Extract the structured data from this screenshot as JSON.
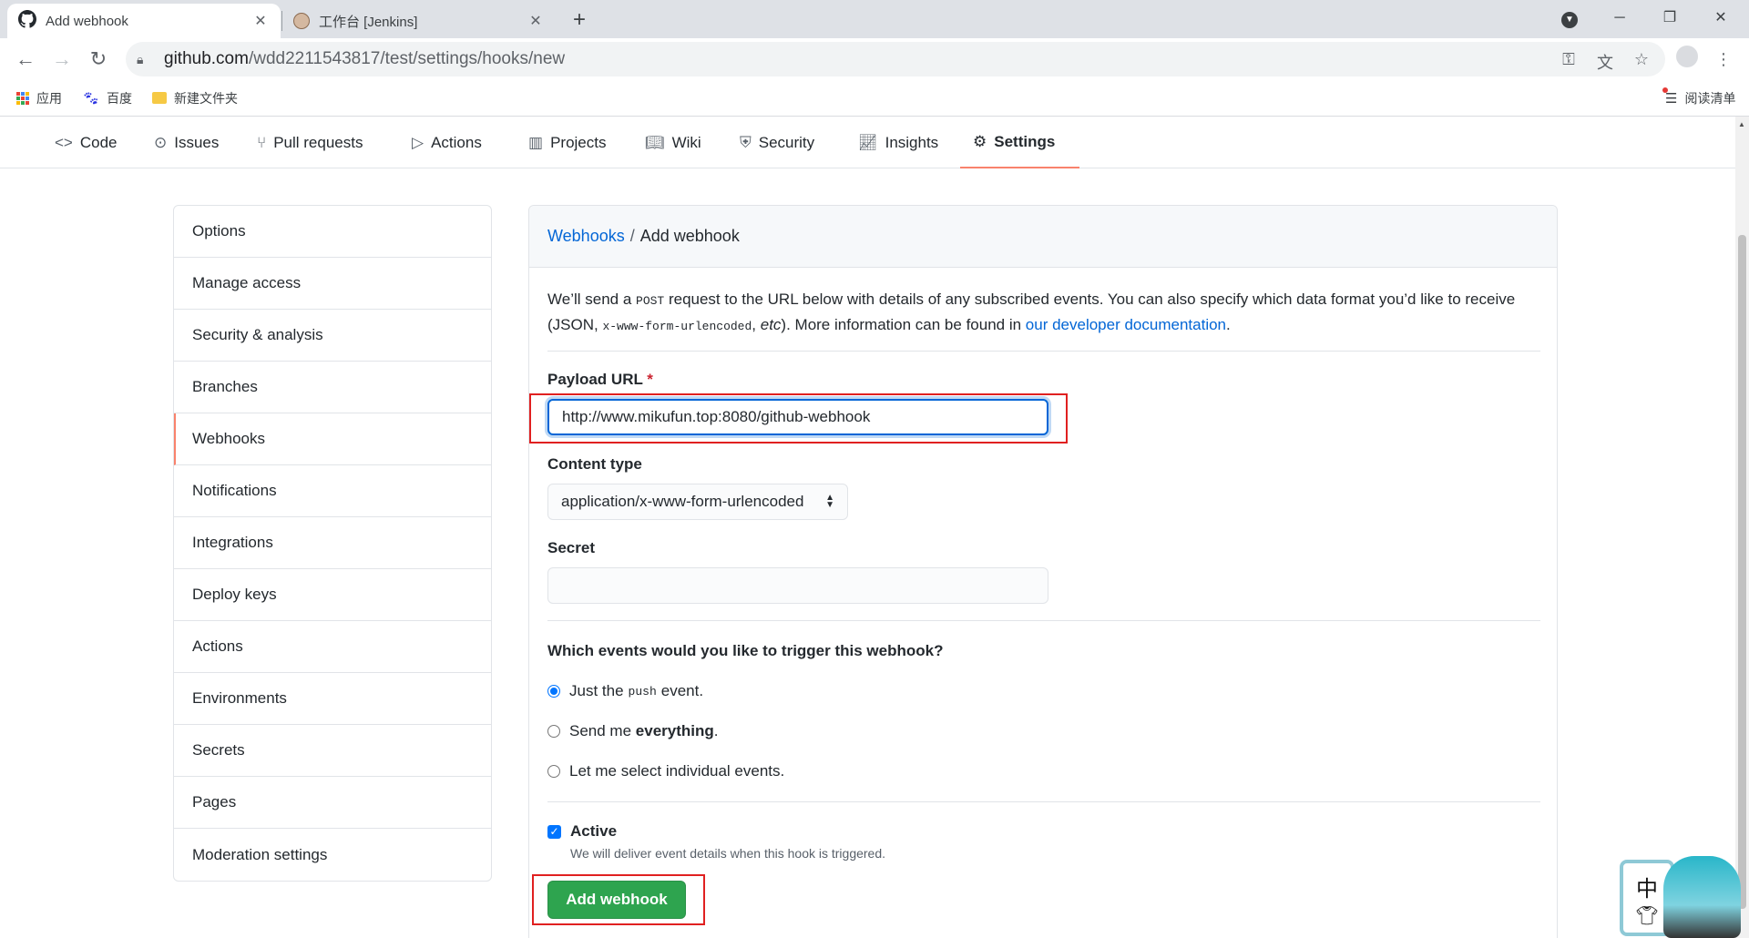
{
  "browser": {
    "tabs": [
      {
        "title": "Add webhook",
        "icon": "github-icon",
        "active": true
      },
      {
        "title": "工作台 [Jenkins]",
        "icon": "jenkins-icon",
        "active": false
      }
    ],
    "url_host": "github.com",
    "url_path": "/wdd2211543817/test/settings/hooks/new",
    "bookmarks": [
      {
        "label": "应用",
        "icon": "apps-grid-icon"
      },
      {
        "label": "百度",
        "icon": "baidu-paw-icon"
      },
      {
        "label": "新建文件夹",
        "icon": "folder-icon"
      }
    ],
    "reading_list": "阅读清单"
  },
  "repo_nav": {
    "items": [
      {
        "label": "Code",
        "icon": "code-icon"
      },
      {
        "label": "Issues",
        "icon": "issue-icon"
      },
      {
        "label": "Pull requests",
        "icon": "pull-request-icon"
      },
      {
        "label": "Actions",
        "icon": "play-icon"
      },
      {
        "label": "Projects",
        "icon": "project-icon"
      },
      {
        "label": "Wiki",
        "icon": "book-icon"
      },
      {
        "label": "Security",
        "icon": "shield-icon"
      },
      {
        "label": "Insights",
        "icon": "graph-icon"
      },
      {
        "label": "Settings",
        "icon": "gear-icon",
        "selected": true
      }
    ]
  },
  "sidebar": {
    "items": [
      {
        "label": "Options"
      },
      {
        "label": "Manage access"
      },
      {
        "label": "Security & analysis"
      },
      {
        "label": "Branches"
      },
      {
        "label": "Webhooks",
        "selected": true
      },
      {
        "label": "Notifications"
      },
      {
        "label": "Integrations"
      },
      {
        "label": "Deploy keys"
      },
      {
        "label": "Actions"
      },
      {
        "label": "Environments"
      },
      {
        "label": "Secrets"
      },
      {
        "label": "Pages"
      },
      {
        "label": "Moderation settings"
      }
    ]
  },
  "main": {
    "breadcrumb_link": "Webhooks",
    "breadcrumb_sep": "/",
    "breadcrumb_current": "Add webhook",
    "intro": {
      "part1": "We’ll send a ",
      "code1": "POST",
      "part2": " request to the URL below with details of any subscribed events. You can also specify which data format you’d like to receive (JSON, ",
      "code2": "x-www-form-urlencoded",
      "part3": ", ",
      "etc": "etc",
      "part4": "). More information can be found in ",
      "link": "our developer documentation",
      "part5": "."
    },
    "payload_url_label": "Payload URL",
    "required_mark": "*",
    "payload_url_value": "http://www.mikufun.top:8080/github-webhook",
    "content_type_label": "Content type",
    "content_type_value": "application/x-www-form-urlencoded",
    "secret_label": "Secret",
    "secret_value": "",
    "events_question": "Which events would you like to trigger this webhook?",
    "events": {
      "push_pre": "Just the",
      "push_code": "push",
      "push_post": "event.",
      "everything_pre": "Send me",
      "everything_bold": "everything",
      "everything_post": ".",
      "individual": "Let me select individual events."
    },
    "active_label": "Active",
    "active_note": "We will deliver event details when this hook is triggered.",
    "submit_label": "Add webhook"
  },
  "widget": {
    "char": "中"
  }
}
